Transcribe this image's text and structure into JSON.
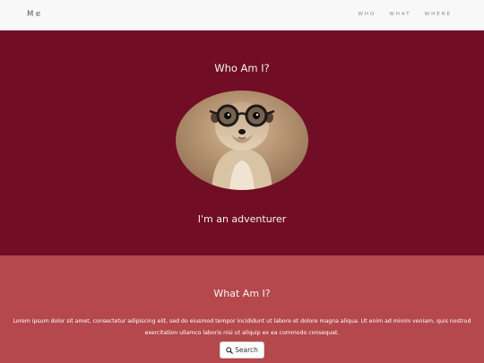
{
  "navbar": {
    "brand": "Me",
    "links": [
      "WHO",
      "WHAT",
      "WHERE"
    ]
  },
  "who": {
    "title": "Who Am I?",
    "tagline": "I'm an adventurer"
  },
  "what": {
    "title": "What Am I?",
    "body": "Lorem ipsum dolor sit amet, consectetur adipiscing elit, sed do eiusmod tempor incididunt ut labore et dolore magna aliqua. Ut enim ad minim veniam, quis nostrud exercitation ullamco laboris nisi ut aliquip ex ea commodo consequat.",
    "search_label": "Search",
    "search_icon": "search-icon"
  },
  "colors": {
    "navbar_bg": "#f8f8f8",
    "who_bg": "#710d25",
    "what_bg": "#b5484c"
  }
}
